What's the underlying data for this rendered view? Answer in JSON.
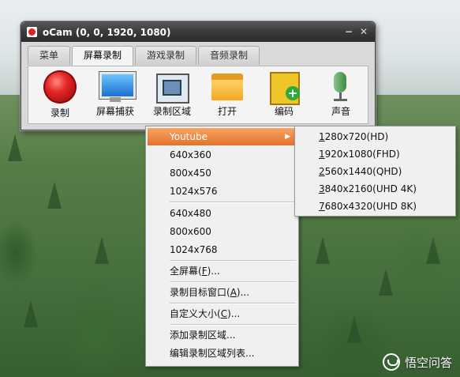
{
  "window": {
    "title": "oCam (0, 0, 1920, 1080)",
    "minimize_glyph": "−",
    "close_glyph": "✕"
  },
  "tabs": [
    {
      "label": "菜单",
      "active": false
    },
    {
      "label": "屏幕录制",
      "active": true
    },
    {
      "label": "游戏录制",
      "active": false
    },
    {
      "label": "音频录制",
      "active": false
    }
  ],
  "toolbar": [
    {
      "label": "录制",
      "icon": "record-icon"
    },
    {
      "label": "屏幕捕获",
      "icon": "monitor-icon"
    },
    {
      "label": "录制区域",
      "icon": "region-icon"
    },
    {
      "label": "打开",
      "icon": "folder-icon"
    },
    {
      "label": "编码",
      "icon": "film-encode-icon"
    },
    {
      "label": "声音",
      "icon": "microphone-icon"
    }
  ],
  "size_menu": {
    "items": [
      "Youtube",
      "640x360",
      "800x450",
      "1024x576",
      "640x480",
      "800x600",
      "1024x768"
    ],
    "highlighted": "Youtube",
    "submenu_arrow": "▶",
    "fullscreen": {
      "pre": "全屏幕(",
      "key": "F",
      "post": ")..."
    },
    "target_window": {
      "pre": "录制目标窗口(",
      "key": "A",
      "post": ")..."
    },
    "custom_size": {
      "pre": "自定义大小(",
      "key": "C",
      "post": ")..."
    },
    "add_region": "添加录制区域...",
    "edit_regions": "编辑录制区域列表..."
  },
  "youtube_submenu": [
    {
      "key": "1",
      "rest": "280x720(HD)"
    },
    {
      "key": "1",
      "rest": "920x1080(FHD)"
    },
    {
      "key": "2",
      "rest": "560x1440(QHD)"
    },
    {
      "key": "3",
      "rest": "840x2160(UHD 4K)"
    },
    {
      "key": "7",
      "rest": "680x4320(UHD 8K)"
    }
  ],
  "watermark": {
    "text": "悟空问答"
  },
  "colors": {
    "highlight": "#e8793a",
    "titlebar": "#3a3a3a",
    "menu_bg": "#f0f0f0"
  }
}
